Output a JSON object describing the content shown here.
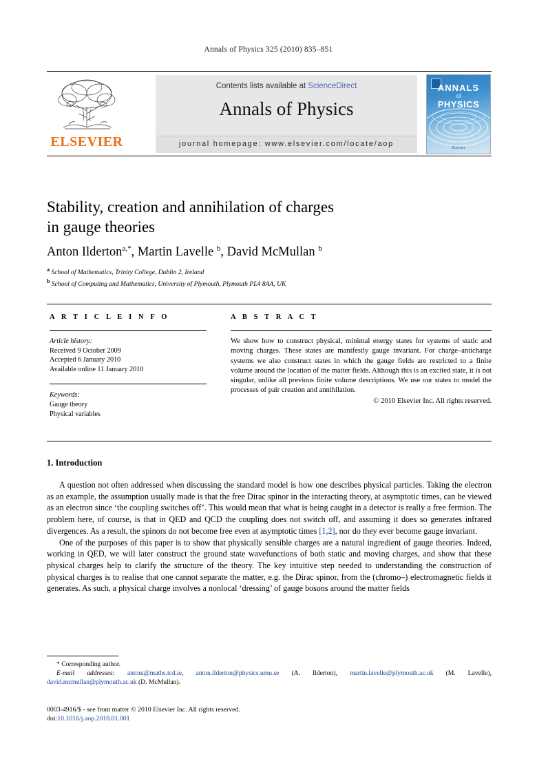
{
  "running_head": "Annals of Physics 325 (2010) 835–851",
  "masthead": {
    "publisher_word": "ELSEVIER",
    "contents_prefix": "Contents lists available at ",
    "contents_link": "ScienceDirect",
    "journal_title": "Annals of Physics",
    "homepage": "journal homepage: www.elsevier.com/locate/aop",
    "cover": {
      "line1": "ANNALS",
      "line2": "of",
      "line3": "PHYSICS",
      "footer": "Elsevier"
    },
    "colors": {
      "elsevier_orange": "#E9711C",
      "link_blue": "#4e69b8",
      "panel_gray": "#e7e7e7",
      "cover_blue": "#2f7fc4"
    }
  },
  "article": {
    "title_line1": "Stability, creation and annihilation of charges",
    "title_line2": "in gauge theories",
    "authors": "Anton Ilderton",
    "author_sup_1": "a,*",
    "author_2": ", Martin Lavelle ",
    "author_sup_2": "b",
    "author_3": ", David McMullan ",
    "author_sup_3": "b",
    "affiliation_a_sup": "a",
    "affiliation_a": " School of Mathematics, Trinity College, Dublin 2, Ireland",
    "affiliation_b_sup": "b",
    "affiliation_b": " School of Computing and Mathematics, University of Plymouth, Plymouth PL4 8AA, UK"
  },
  "info": {
    "heading": "A R T I C L E   I N F O",
    "history_label": "Article history:",
    "history": [
      "Received 9 October 2009",
      "Accepted 6 January 2010",
      "Available online 11 January 2010"
    ],
    "keywords_label": "Keywords:",
    "keywords": [
      "Gauge theory",
      "Physical variables"
    ]
  },
  "abstract": {
    "heading": "A B S T R A C T",
    "text": "We show how to construct physical, minimal energy states for systems of static and moving charges. These states are manifestly gauge invariant. For charge–anticharge systems we also construct states in which the gauge fields are restricted to a finite volume around the location of the matter fields. Although this is an excited state, it is not singular, unlike all previous finite volume descriptions. We use our states to model the processes of pair creation and annihilation.",
    "copyright": "© 2010 Elsevier Inc. All rights reserved."
  },
  "body": {
    "section_heading": "1. Introduction",
    "para1_a": "A question not often addressed when discussing the standard model is how one describes physical particles. Taking the electron as an example, the assumption usually made is that the free Dirac spinor in the interacting theory, at asymptotic times, can be viewed as an electron since ‘the coupling switches off’. This would mean that what is being caught in a detector is really a free fermion. The problem here, of course, is that in QED and QCD the coupling does not switch off, and assuming it does so generates infrared divergences. As a result, the spinors do not become free even at asymptotic times ",
    "para1_ref": "[1,2]",
    "para1_b": ", nor do they ever become gauge invariant.",
    "para2": "One of the purposes of this paper is to show that physically sensible charges are a natural ingredient of gauge theories. Indeed, working in QED, we will later construct the ground state wavefunctions of both static and moving charges, and show that these physical charges help to clarify the structure of the theory. The key intuitive step needed to understanding the construction of physical charges is to realise that one cannot separate the matter, e.g. the Dirac spinor, from the (chromo–) electromagnetic fields it generates. As such, a physical charge involves a nonlocal ‘dressing’ of gauge bosons around the matter fields"
  },
  "footnotes": {
    "corresponding": "* Corresponding author.",
    "email_label": "E-mail addresses:",
    "emails": [
      {
        "address": "antoni@maths.tcd.ie",
        "owner": ""
      },
      {
        "address": "anton.ilderton@physics.umu.se",
        "owner": "(A. Ilderton)"
      },
      {
        "address": "martin.lavelle@plymouth.ac.uk",
        "owner": "(M. Lavelle)"
      },
      {
        "address": "david.mcmullan@plymouth.ac.uk",
        "owner": "(D. McMullan)"
      }
    ]
  },
  "colophon": {
    "issn_line": "0003-4916/$ - see front matter © 2010 Elsevier Inc. All rights reserved.",
    "doi_prefix": "doi:",
    "doi": "10.1016/j.aop.2010.01.001"
  }
}
